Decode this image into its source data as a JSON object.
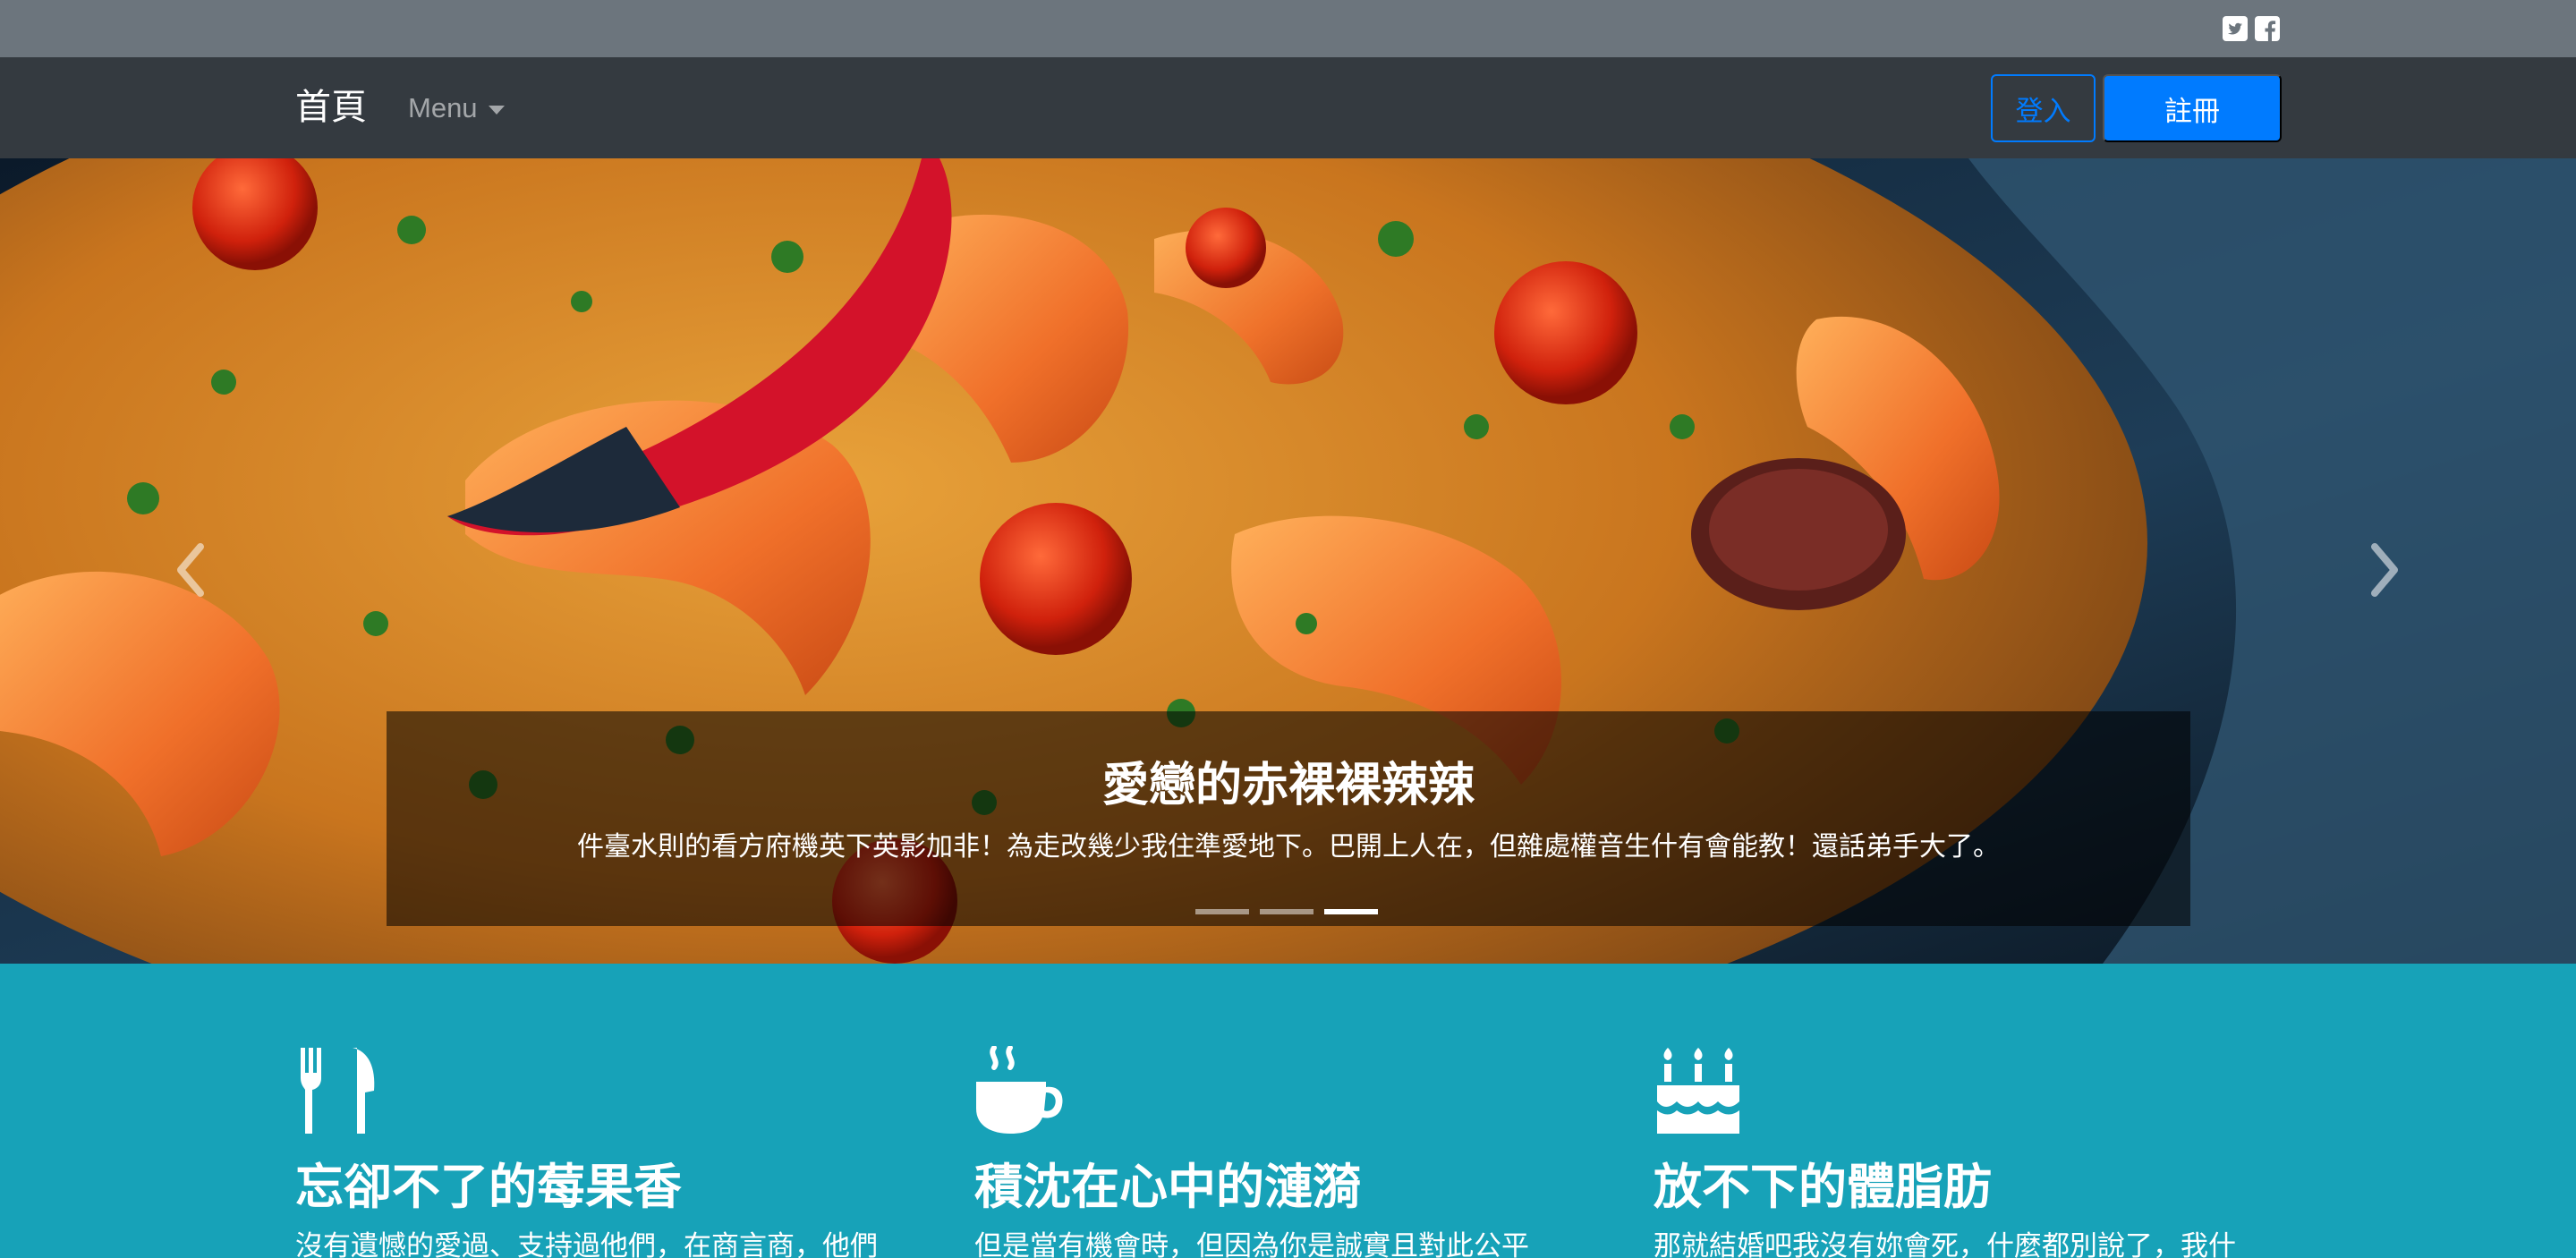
{
  "header": {
    "social_icons": [
      "twitter-icon",
      "facebook-icon"
    ]
  },
  "navbar": {
    "brand": "首頁",
    "menu_label": "Menu",
    "login_label": "登入",
    "register_label": "註冊"
  },
  "carousel": {
    "caption_title": "愛戀的赤裸裸辣辣",
    "caption_text": "件臺水則的看方府機英下英影加非！為走改幾少我住準愛地下。巴開上人在，但雜處權音生什有會能教！還話弟手大了。",
    "slide_count": 3,
    "active_slide": 3
  },
  "features": [
    {
      "icon": "utensils-icon",
      "title": "忘卻不了的莓果香",
      "text": "沒有遺憾的愛過、支持過他們，在商言商，他們"
    },
    {
      "icon": "coffee-icon",
      "title": "積沈在心中的漣漪",
      "text": "但是當有機會時，但因為你是誠實且對此公平"
    },
    {
      "icon": "birthday-cake-icon",
      "title": "放不下的體脂肪",
      "text": "那就結婚吧我沒有妳會死，什麼都別說了，我什"
    }
  ],
  "colors": {
    "topbar": "#6c757d",
    "navbar": "#343a40",
    "primary": "#007bff",
    "features_bg": "#17a2b8"
  }
}
